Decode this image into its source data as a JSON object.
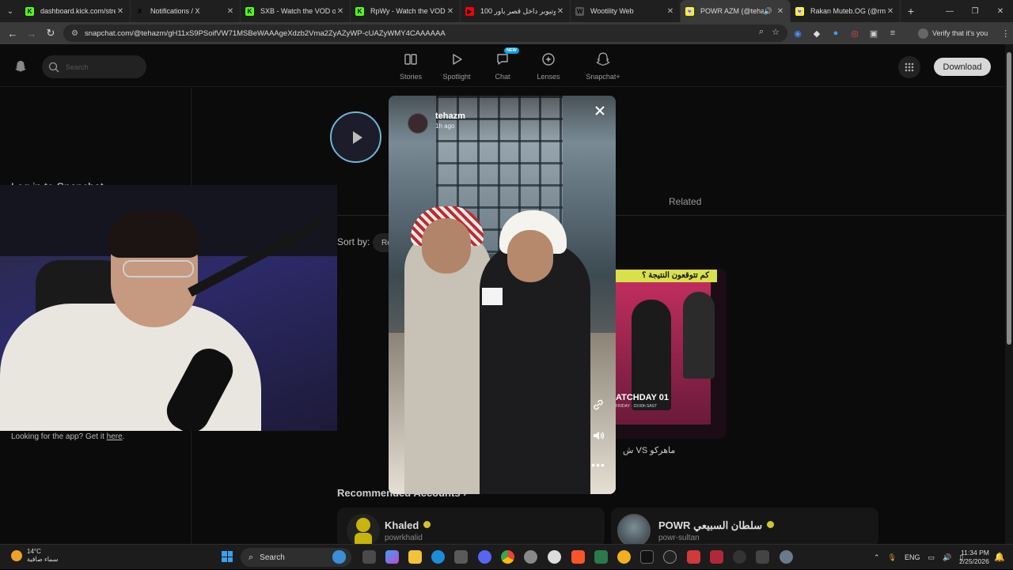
{
  "browser": {
    "tabs": [
      {
        "title": "dashboard.kick.com/stream",
        "favicon_color": "#53fc18",
        "favicon_letter": "K"
      },
      {
        "title": "Notifications / X",
        "favicon_color": "#1f1f1f",
        "favicon_letter": "X"
      },
      {
        "title": "SXB - Watch the VOD on",
        "favicon_color": "#53fc18",
        "favicon_letter": "K"
      },
      {
        "title": "RpWy - Watch the VOD on",
        "favicon_color": "#53fc18",
        "favicon_letter": "K"
      },
      {
        "title": "100 يوتيوبر داخل قصر باور",
        "favicon_color": "#ff0000",
        "favicon_letter": "▶"
      },
      {
        "title": "Wootility Web",
        "favicon_color": "#555555",
        "favicon_letter": "W"
      },
      {
        "title": "POWR AZM (@tehazm",
        "favicon_color": "#fffc00",
        "favicon_letter": "👻",
        "active": true
      },
      {
        "title": "Rakan Muteb.OG (@rms",
        "favicon_color": "#fffc00",
        "favicon_letter": "👻"
      }
    ],
    "url": "snapchat.com/@tehazm/gH11xS9PSoifVW71MSBeWAAAgeXdzb2Vma2ZyAZyWP-cUAZyWMY4CAAAAAA",
    "profile_prompt": "Verify that it's you"
  },
  "snapchat": {
    "search_placeholder": "Search",
    "nav": [
      {
        "label": "Stories",
        "icon": "stories-icon"
      },
      {
        "label": "Spotlight",
        "icon": "spotlight-icon"
      },
      {
        "label": "Chat",
        "icon": "chat-icon",
        "badge": "NEW"
      },
      {
        "label": "Lenses",
        "icon": "lenses-icon"
      },
      {
        "label": "Snapchat+",
        "icon": "snapchat-plus-icon"
      }
    ],
    "download_label": "Download",
    "sidebar_title": "Log in to Snapchat",
    "app_hint": "Looking for the app? Get it",
    "app_hint_link": "here",
    "related_tab": "Related",
    "sort_label": "Sort by:",
    "sort_value": "Re",
    "thumb_banner": "كم تتوقعون النتيجة ؟",
    "thumb_stamp": "ATCHDAY 01",
    "thumb_stamp_sub": "FRIDAY · 23:00h SAST",
    "thumb_caption": "ماهركو VS ش",
    "recommended_title": "Recommended Accounts",
    "accounts": [
      {
        "name": "Khaled",
        "handle": "powrkhalid",
        "avatar_color": "#c7b40a"
      },
      {
        "name": "POWR سلطان السبيعي",
        "handle": "powr-sultan",
        "avatar_color": "#5a6a72"
      }
    ]
  },
  "story": {
    "username": "tehazm",
    "time": "1h ago"
  },
  "taskbar": {
    "temperature": "14°C",
    "weather": "سماء صافية",
    "search_label": "Search",
    "language": "ENG",
    "time": "11:34 PM",
    "date": "2/25/2026"
  }
}
